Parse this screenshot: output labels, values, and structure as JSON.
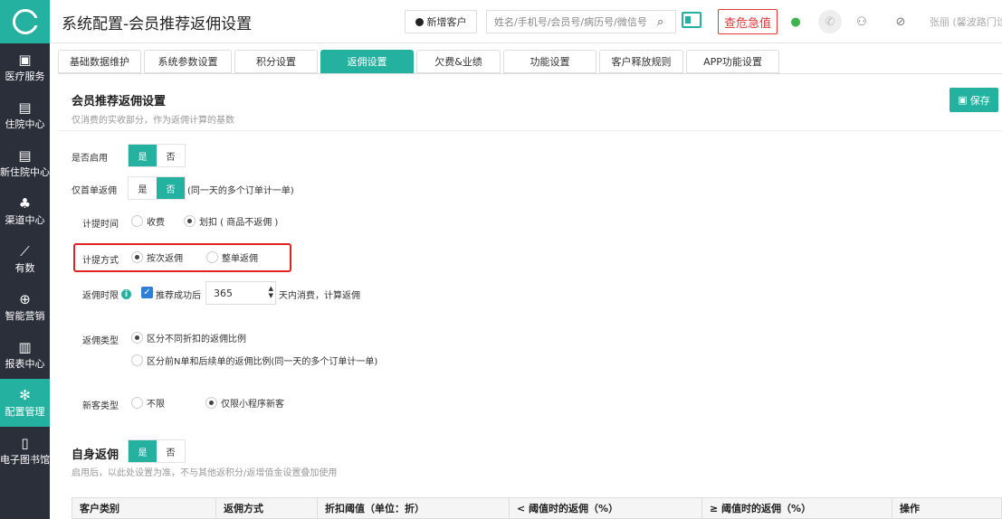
{
  "sidebar": {
    "items": [
      {
        "label": "医疗服务",
        "icon": "medical-icon"
      },
      {
        "label": "住院中心",
        "icon": "hospital-icon"
      },
      {
        "label": "新住院中心",
        "icon": "hospital-icon"
      },
      {
        "label": "渠道中心",
        "icon": "channel-icon"
      },
      {
        "label": "有数",
        "icon": "chart-icon"
      },
      {
        "label": "智能营销",
        "icon": "marketing-icon"
      },
      {
        "label": "报表中心",
        "icon": "report-icon"
      },
      {
        "label": "配置管理",
        "icon": "gear-icon",
        "active": true
      },
      {
        "label": "电子图书馆",
        "icon": "book-icon"
      }
    ]
  },
  "header": {
    "title": "系统配置-会员推荐返佣设置",
    "add_customer": "新增客户",
    "search_placeholder": "姓名/手机号/会员号/病历号/微信号",
    "danger_label": "查危急值",
    "user": "张丽 (馨波路门诊)"
  },
  "tabs": [
    {
      "label": "基础数据维护"
    },
    {
      "label": "系统参数设置"
    },
    {
      "label": "积分设置"
    },
    {
      "label": "返佣设置",
      "active": true
    },
    {
      "label": "欠费&业绩"
    },
    {
      "label": "功能设置"
    },
    {
      "label": "客户释放规则"
    },
    {
      "label": "APP功能设置"
    }
  ],
  "section": {
    "title": "会员推荐返佣设置",
    "subtitle": "仅消费的实收部分，作为返佣计算的基数",
    "save": "保存"
  },
  "form": {
    "enable": {
      "label": "是否启用",
      "yes": "是",
      "no": "否",
      "selected": "是"
    },
    "first_order": {
      "label": "仅首单返佣",
      "yes": "是",
      "no": "否",
      "selected": "否",
      "note": "(同一天的多个订单计一单)"
    },
    "accrual_time": {
      "label": "计提时间",
      "opt1": "收费",
      "opt2": "划扣 ( 商品不返佣 )",
      "selected": "划扣 ( 商品不返佣 )"
    },
    "accrual_method": {
      "label": "计提方式",
      "opt1": "按次返佣",
      "opt2": "整单返佣",
      "selected": "按次返佣"
    },
    "time_limit": {
      "label": "返佣时限",
      "checkbox": "推荐成功后",
      "checked": true,
      "days": "365",
      "suffix": "天内消费，计算返佣"
    },
    "rebate_type": {
      "label": "返佣类型",
      "opt1": "区分不同折扣的返佣比例",
      "opt2": "区分前N单和后续单的返佣比例(同一天的多个订单计一单)",
      "selected": "区分不同折扣的返佣比例"
    },
    "new_customer": {
      "label": "新客类型",
      "opt1": "不限",
      "opt2": "仅限小程序新客",
      "selected": "仅限小程序新客"
    }
  },
  "self_rebate": {
    "title": "自身返佣",
    "yes": "是",
    "no": "否",
    "selected": "是",
    "note": "启用后，以此处设置为准，不与其他返积分/返增值金设置叠加使用"
  },
  "table": {
    "headers": [
      "客户类别",
      "返佣方式",
      "折扣阈值（单位：折）",
      "< 阈值时的返佣（%）",
      "≥ 阈值时的返佣（%）",
      "操作"
    ]
  },
  "colors": {
    "accent": "#24b1a0",
    "danger": "#e03a3a",
    "sidebar": "#2b2f3a"
  }
}
